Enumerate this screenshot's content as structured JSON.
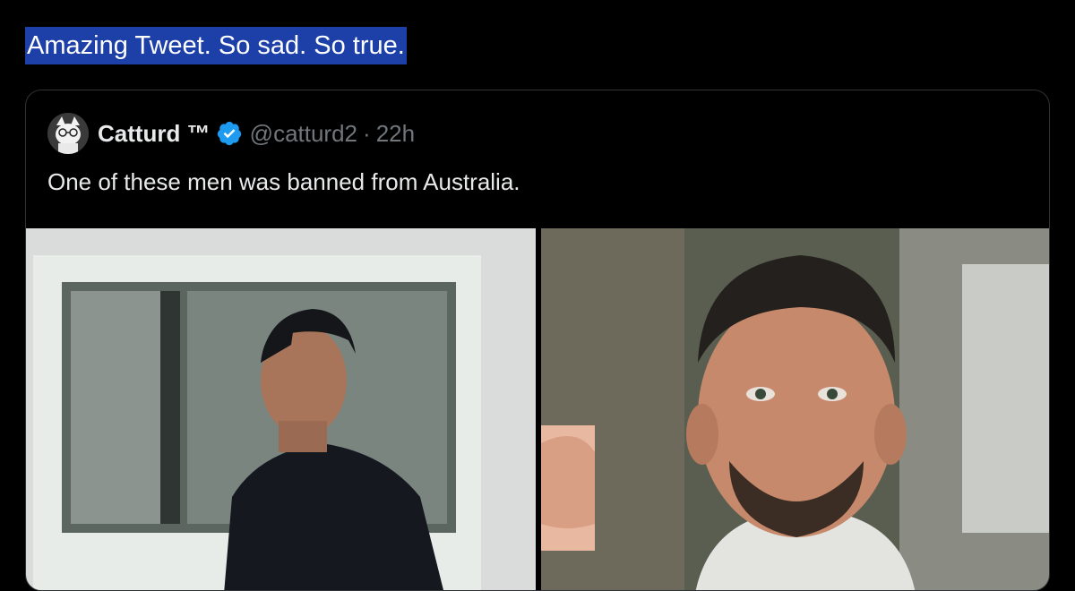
{
  "post": {
    "text": "Amazing Tweet. So sad. So true."
  },
  "quoted_tweet": {
    "display_name": "Catturd ™",
    "verified_icon": "verified-badge-icon",
    "handle": "@catturd2",
    "separator": "·",
    "timestamp": "22h",
    "text": "One of these men was banned from Australia.",
    "media": [
      "photo-young-man-dark-hoodie",
      "photo-tennis-player-fist"
    ]
  },
  "colors": {
    "background": "#000000",
    "text_primary": "#e7e9ea",
    "text_secondary": "#71767b",
    "selection_highlight": "#1c3fa8",
    "verified_blue": "#1d9bf0",
    "card_border": "#2f3336"
  }
}
